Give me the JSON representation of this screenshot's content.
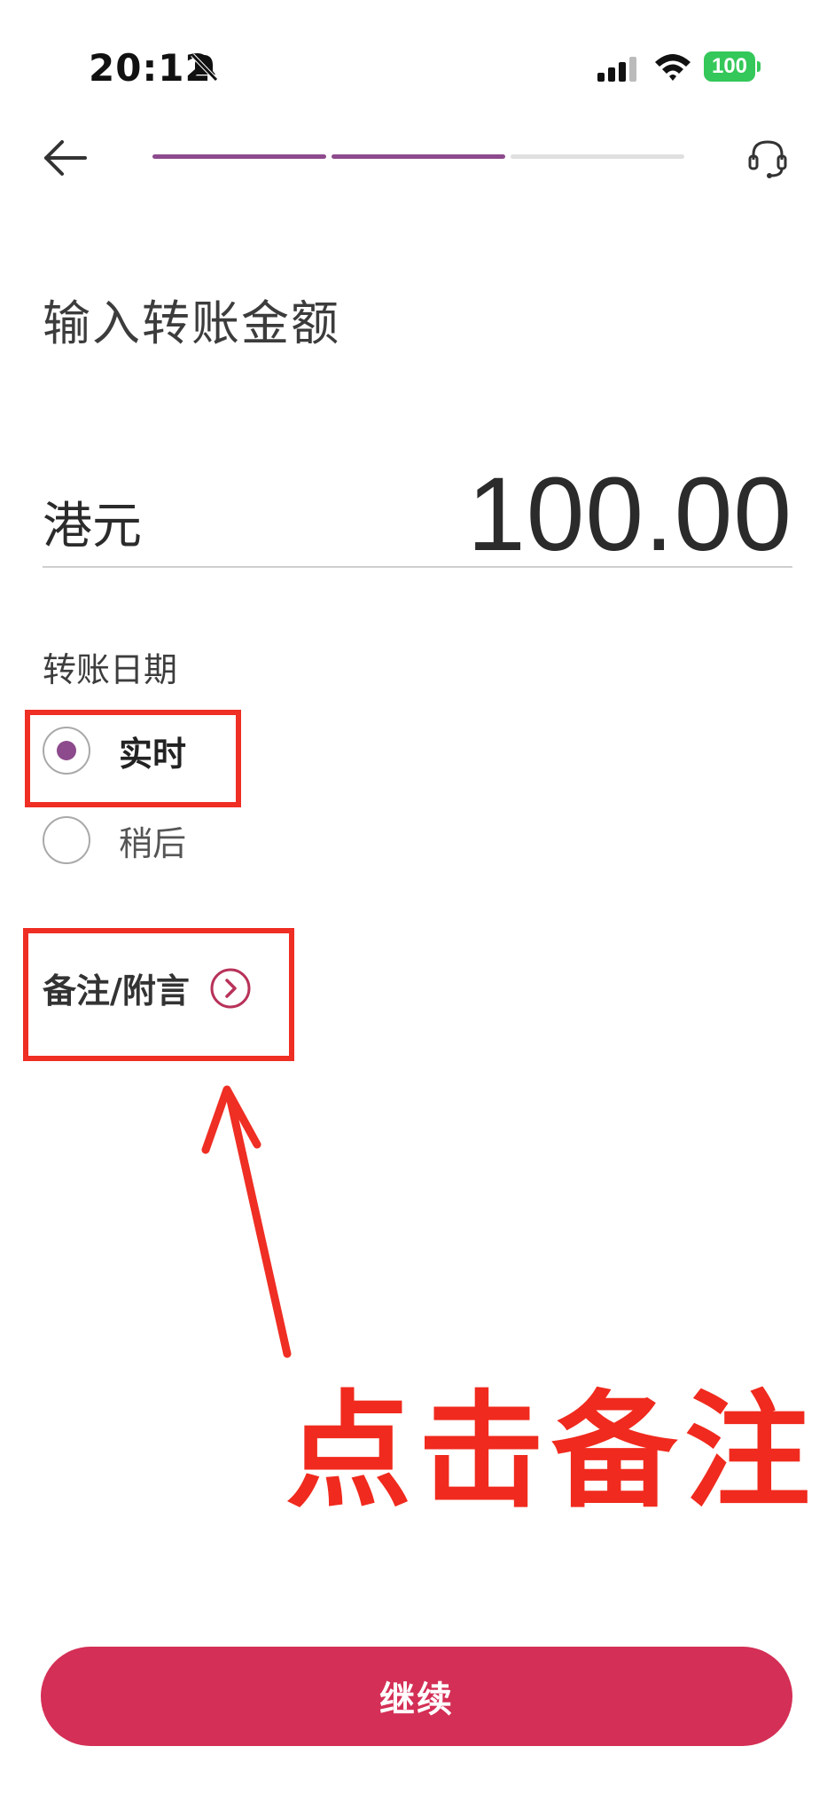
{
  "status_bar": {
    "time": "20:12",
    "battery": "100",
    "icons": [
      "bell-muted-icon",
      "signal-icon",
      "wifi-icon",
      "battery-icon"
    ]
  },
  "nav": {
    "back_icon": "arrow-left-icon",
    "support_icon": "headset-icon",
    "progress": {
      "completed_steps": 2,
      "total_steps": 3
    }
  },
  "title": "输入转账金额",
  "amount": {
    "currency": "港元",
    "value": "100.00"
  },
  "transfer_date": {
    "label": "转账日期",
    "options": [
      {
        "label": "实时",
        "selected": true
      },
      {
        "label": "稍后",
        "selected": false
      }
    ]
  },
  "memo": {
    "label": "备注/附言",
    "icon": "chevron-right-circle-icon"
  },
  "annotation": {
    "text": "点击备注"
  },
  "continue_button": {
    "label": "继续"
  },
  "colors": {
    "accent": "#8d4a8c",
    "progress_inactive": "#e0e0e0",
    "button": "#d42f56",
    "memo_icon": "#b8325a",
    "annotation_red": "#ef2e24",
    "battery_green": "#34c759"
  }
}
